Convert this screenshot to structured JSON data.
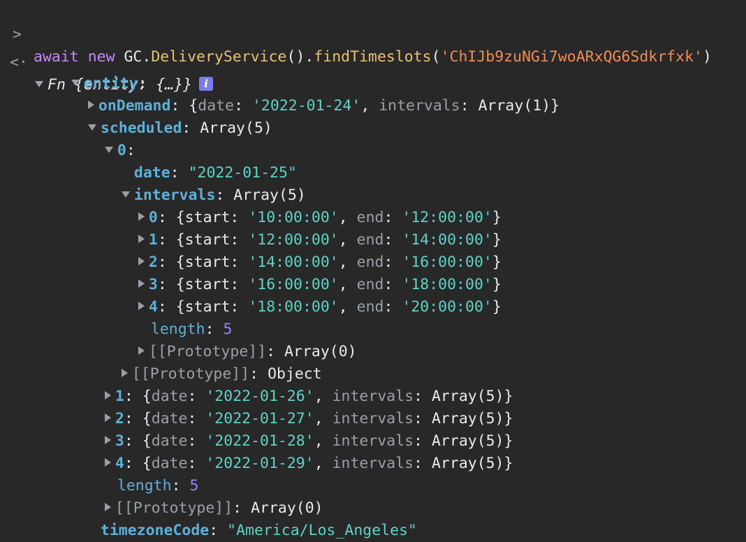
{
  "input": {
    "await_kw": "await",
    "new_kw": "new",
    "obj": "GC.",
    "cls": "DeliveryService",
    "parens": "().",
    "method": "findTimeslots",
    "open": "(",
    "arg": "'ChIJb9zuNGi7woARxQG6Sdkrfxk'",
    "close": ")"
  },
  "result": {
    "summary": "Fn {entity: {…}}",
    "info_glyph": "i"
  },
  "tree": {
    "entity_key": "entity",
    "onDemand": {
      "key": "onDemand",
      "date_key": "date",
      "date": "'2022-01-24'",
      "intervals_key": "intervals",
      "intervals_preview": "Array(1)"
    },
    "scheduled": {
      "key": "scheduled",
      "preview": "Array(5)",
      "item0": {
        "index": "0",
        "date_key": "date",
        "date": "\"2022-01-25\"",
        "intervals_key": "intervals",
        "intervals_preview": "Array(5)",
        "intervals": [
          {
            "index": "0",
            "start": "'10:00:00'",
            "end": "'12:00:00'"
          },
          {
            "index": "1",
            "start": "'12:00:00'",
            "end": "'14:00:00'"
          },
          {
            "index": "2",
            "start": "'14:00:00'",
            "end": "'16:00:00'"
          },
          {
            "index": "3",
            "start": "'16:00:00'",
            "end": "'18:00:00'"
          },
          {
            "index": "4",
            "start": "'18:00:00'",
            "end": "'20:00:00'"
          }
        ],
        "intervals_length_key": "length",
        "intervals_length": "5",
        "intervals_proto_key": "[[Prototype]]",
        "intervals_proto": "Array(0)",
        "proto_key": "[[Prototype]]",
        "proto": "Object"
      },
      "rest": [
        {
          "index": "1",
          "date": "'2022-01-26'",
          "intervals": "Array(5)"
        },
        {
          "index": "2",
          "date": "'2022-01-27'",
          "intervals": "Array(5)"
        },
        {
          "index": "3",
          "date": "'2022-01-28'",
          "intervals": "Array(5)"
        },
        {
          "index": "4",
          "date": "'2022-01-29'",
          "intervals": "Array(5)"
        }
      ],
      "length_key": "length",
      "length": "5",
      "proto_key": "[[Prototype]]",
      "proto": "Array(0)"
    },
    "timezone_key": "timezoneCode",
    "timezone": "\"America/Los_Angeles\""
  },
  "labels": {
    "start_key": "start",
    "end_key": "end",
    "date_key": "date",
    "intervals_key": "intervals"
  },
  "colors": {
    "background": "#282828",
    "key": "#5db0d7",
    "string": "#5cd5c6",
    "number": "#9980ff",
    "keyword": "#c58af9",
    "arg_string": "#f28b54"
  }
}
